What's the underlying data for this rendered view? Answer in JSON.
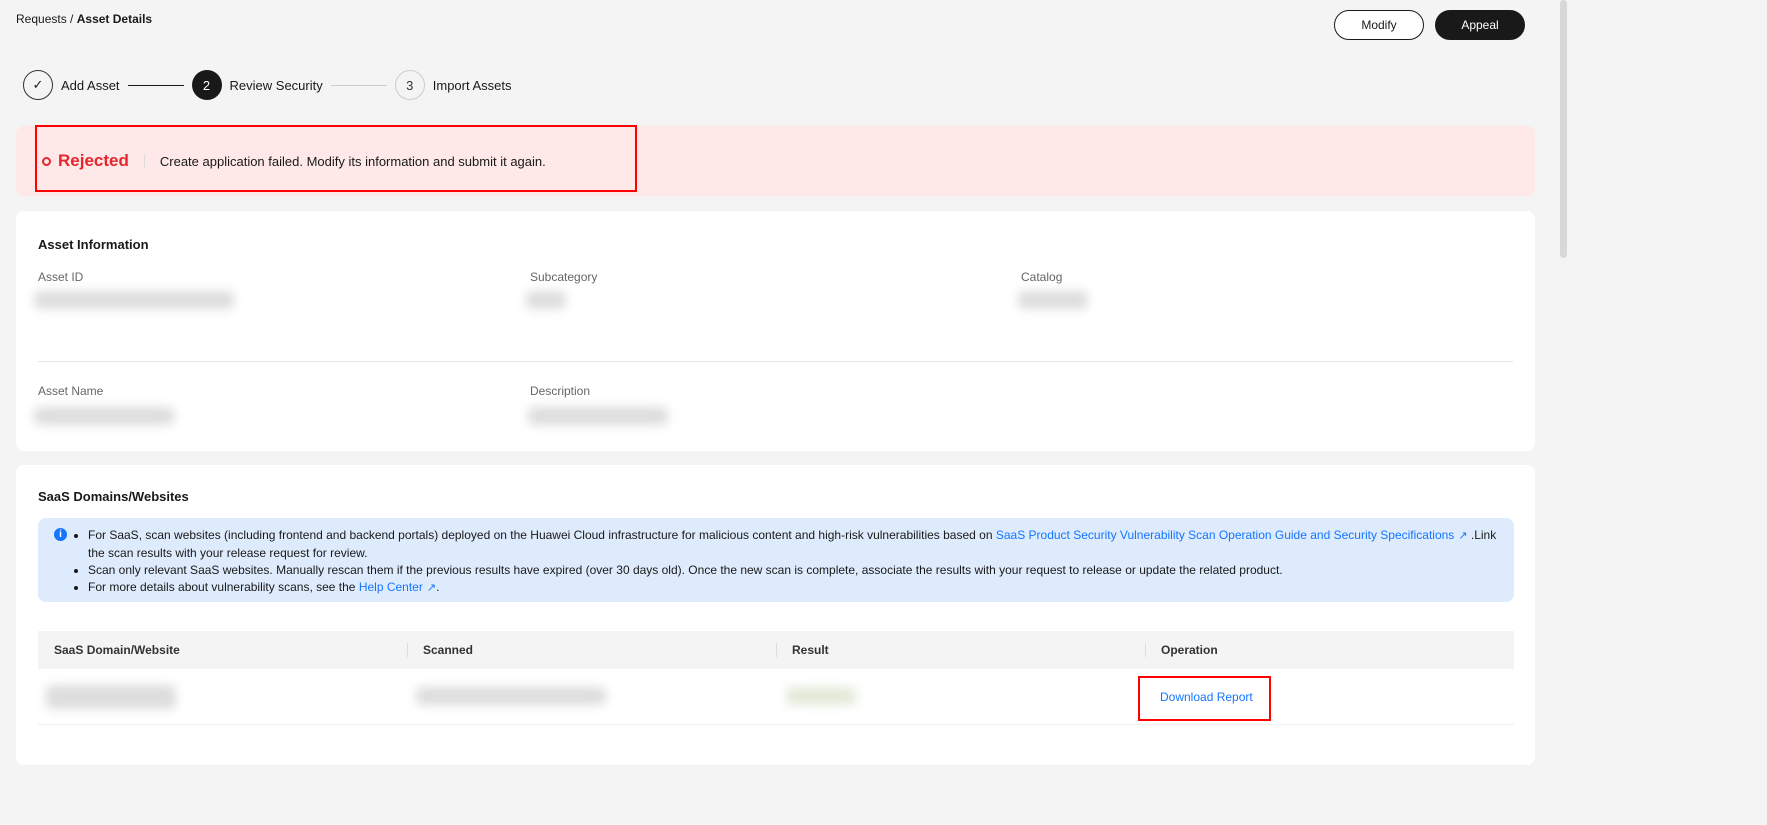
{
  "breadcrumb": {
    "parent": "Requests",
    "separator": "/",
    "current": "Asset Details"
  },
  "actions": {
    "modify": "Modify",
    "appeal": "Appeal"
  },
  "steps": [
    {
      "number": "1",
      "label": "Add Asset",
      "state": "done"
    },
    {
      "number": "2",
      "label": "Review Security",
      "state": "active"
    },
    {
      "number": "3",
      "label": "Import Assets",
      "state": "todo"
    }
  ],
  "status": {
    "label": "Rejected",
    "message": "Create application failed. Modify its information and submit it again.",
    "color": "#e5262c"
  },
  "asset_info": {
    "title": "Asset Information",
    "fields": {
      "asset_id": "Asset ID",
      "subcategory": "Subcategory",
      "catalog": "Catalog",
      "asset_name": "Asset Name",
      "description": "Description"
    }
  },
  "saas": {
    "title": "SaaS Domains/Websites",
    "notes": {
      "n1_pre": "For SaaS, scan websites (including frontend and backend portals) deployed on the Huawei Cloud infrastructure for malicious content and high-risk vulnerabilities based on ",
      "n1_link": "SaaS Product Security Vulnerability Scan Operation Guide and Security Specifications",
      "n1_post": " .Link the scan results with your release request for review.",
      "n2": "Scan only relevant SaaS websites. Manually rescan them if the previous results have expired (over 30 days old). Once the new scan is complete, associate the results with your request to release or update the related product.",
      "n3_pre": "For more details about vulnerability scans, see the ",
      "n3_link": "Help Center",
      "n3_post": "."
    },
    "columns": [
      "SaaS Domain/Website",
      "Scanned",
      "Result",
      "Operation"
    ],
    "row": {
      "operation": "Download Report"
    }
  },
  "colors": {
    "accent": "#1476ff",
    "info_bg": "#deebfd",
    "alert_bg": "#ffe9e8"
  }
}
